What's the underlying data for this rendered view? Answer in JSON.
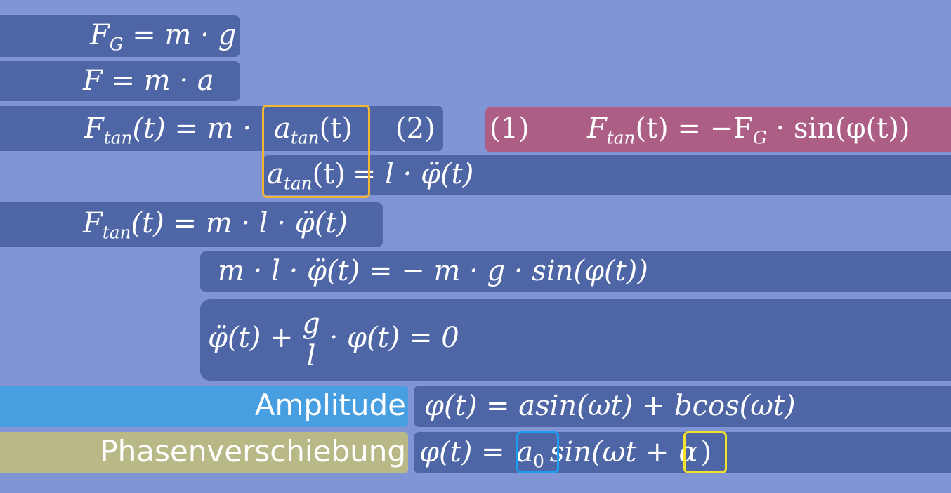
{
  "equations": {
    "eq_fg": "F",
    "eq_fg_sub": "G",
    "eq_fg_rhs": " = m · g",
    "eq_fma": "F  =  m  · a",
    "eq_ftan_lhs": "F",
    "eq_ftan_sub": "tan",
    "eq_ftan_mid": "(t) = m · ",
    "eq_atan": "a",
    "eq_atan_sub": "tan",
    "eq_atan_t": "(t)",
    "eq_num2": "(2)",
    "eq_num1": "(1)",
    "eq_red_f": "F",
    "eq_red_sub1": "tan",
    "eq_red_mid": "(t) = −F",
    "eq_red_sub2": "G",
    "eq_red_rhs": " · sin(φ(t))",
    "eq_atan2": "a",
    "eq_atan2_sub": "tan",
    "eq_atan2_t": "(t)",
    "eq_atan2_rhs": "= l · φ̈(t)",
    "eq_ftan3_f": "F",
    "eq_ftan3_sub": "tan",
    "eq_ftan3_rhs": "(t) = m · l · φ̈(t)",
    "eq_newton": "m · l · φ̈(t)  =   − m  ·  g  ·  sin(φ(t))",
    "eq_diff_lhs": "φ̈(t)  +  ",
    "eq_diff_num": "g",
    "eq_diff_den": "l",
    "eq_diff_rhs": "  ·      φ(t)       =   0",
    "eq_sol1": "φ(t) = asin(ωt) + bcos(ωt)",
    "eq_sol2_lhs": "φ(t) =",
    "eq_sol2_a": "a",
    "eq_sol2_a_sub": "0",
    "eq_sol2_mid": "sin(ωt +",
    "eq_sol2_alpha": "α",
    "eq_sol2_close": ")"
  },
  "labels": {
    "amplitude": "Amplitude",
    "phase_shift": "Phasenverschiebung"
  },
  "colors": {
    "background": "#8194d3",
    "box": "#4e65a6",
    "red_box": "#ad5e85",
    "amplitude_box": "#479ee1",
    "phase_box": "#b9b988",
    "orange_highlight": "#f2b534",
    "blue_highlight": "#1a9ff0",
    "yellow_highlight": "#f2e22a"
  }
}
